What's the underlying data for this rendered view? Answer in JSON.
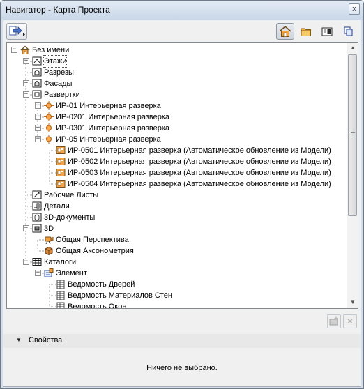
{
  "window": {
    "title": "Навигатор - Карта Проекта",
    "close_label": "x"
  },
  "toolbar": {
    "buttons": [
      {
        "name": "project-map-icon",
        "active": true
      },
      {
        "name": "view-map-icon",
        "active": false
      },
      {
        "name": "layout-book-icon",
        "active": false
      },
      {
        "name": "publisher-sets-icon",
        "active": false
      }
    ]
  },
  "tree": {
    "items": [
      {
        "label": "Без имени",
        "level": 0,
        "expander": "−",
        "icon": "project-house"
      },
      {
        "label": "Этажи",
        "level": 1,
        "expander": "+",
        "icon": "stories",
        "selected": true
      },
      {
        "label": "Разрезы",
        "level": 1,
        "expander": "",
        "icon": "section"
      },
      {
        "label": "Фасады",
        "level": 1,
        "expander": "+",
        "icon": "elevation"
      },
      {
        "label": "Развертки",
        "level": 1,
        "expander": "−",
        "icon": "interior-elevation"
      },
      {
        "label": "ИР-01  Интерьерная разверка",
        "level": 2,
        "expander": "+",
        "icon": "ie-marker"
      },
      {
        "label": "ИР-0201 Интерьерная разверка",
        "level": 2,
        "expander": "+",
        "icon": "ie-marker"
      },
      {
        "label": "ИР-0301 Интерьерная разверка",
        "level": 2,
        "expander": "+",
        "icon": "ie-marker"
      },
      {
        "label": "ИР-05  Интерьерная разверка",
        "level": 2,
        "expander": "−",
        "icon": "ie-marker"
      },
      {
        "label": "ИР-0501 Интерьерная разверка (Автоматическое обновление из Модели)",
        "level": 3,
        "expander": "",
        "icon": "ie-view"
      },
      {
        "label": "ИР-0502 Интерьерная разверка (Автоматическое обновление из Модели)",
        "level": 3,
        "expander": "",
        "icon": "ie-view"
      },
      {
        "label": "ИР-0503 Интерьерная разверка (Автоматическое обновление из Модели)",
        "level": 3,
        "expander": "",
        "icon": "ie-view"
      },
      {
        "label": "ИР-0504 Интерьерная разверка (Автоматическое обновление из Модели)",
        "level": 3,
        "expander": "",
        "icon": "ie-view"
      },
      {
        "label": "Рабочие Листы",
        "level": 1,
        "expander": "",
        "icon": "worksheet"
      },
      {
        "label": "Детали",
        "level": 1,
        "expander": "",
        "icon": "detail"
      },
      {
        "label": "3D-документы",
        "level": 1,
        "expander": "",
        "icon": "3d-document"
      },
      {
        "label": "3D",
        "level": 1,
        "expander": "−",
        "icon": "3d"
      },
      {
        "label": "Общая Перспектива",
        "level": 2,
        "expander": "",
        "icon": "perspective-camera"
      },
      {
        "label": "Общая Аксонометрия",
        "level": 2,
        "expander": "",
        "icon": "axonometry-box"
      },
      {
        "label": "Каталоги",
        "level": 1,
        "expander": "−",
        "icon": "schedules"
      },
      {
        "label": "Элемент",
        "level": 2,
        "expander": "−",
        "icon": "element-folder"
      },
      {
        "label": "Ведомость Дверей",
        "level": 3,
        "expander": "",
        "icon": "schedule-table"
      },
      {
        "label": "Ведомость Материалов Стен",
        "level": 3,
        "expander": "",
        "icon": "schedule-table"
      },
      {
        "label": "Ведомость Окон",
        "level": 3,
        "expander": "",
        "icon": "schedule-table"
      }
    ]
  },
  "bottom": {
    "new_folder_label": "",
    "delete_label": "✕"
  },
  "properties": {
    "title": "Свойства",
    "empty_text": "Ничего не выбрано."
  },
  "colors": {
    "accent_orange": "#e07a10",
    "title_bg": "#d4dde9",
    "tree_line": "#a0a0a0"
  }
}
